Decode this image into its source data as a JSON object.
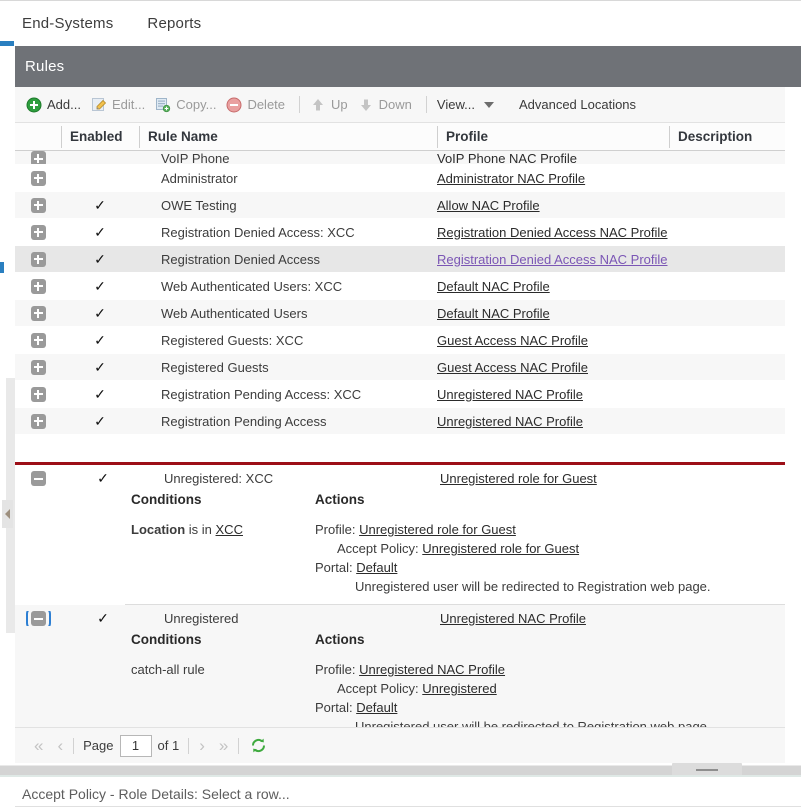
{
  "topbar": {
    "tabs": [
      {
        "label": "End-Systems"
      },
      {
        "label": "Reports"
      }
    ]
  },
  "panel": {
    "title": "Rules"
  },
  "toolbar": {
    "buttons": [
      {
        "label": "Add...",
        "icon": "add-circle-icon",
        "enabled": true
      },
      {
        "label": "Edit...",
        "icon": "edit-pencil-icon",
        "enabled": false
      },
      {
        "label": "Copy...",
        "icon": "copy-icon",
        "enabled": false
      },
      {
        "label": "Delete",
        "icon": "delete-circle-icon",
        "enabled": false
      },
      {
        "label": "Up",
        "icon": "arrow-up-icon",
        "enabled": false
      },
      {
        "label": "Down",
        "icon": "arrow-down-icon",
        "enabled": false
      },
      {
        "label": "View...",
        "icon": "chevron-down-icon",
        "enabled": true
      }
    ],
    "advanced_locations_label": "Advanced Locations"
  },
  "grid": {
    "columns": [
      {
        "key": "expand",
        "label": ""
      },
      {
        "key": "enabled",
        "label": "Enabled"
      },
      {
        "key": "rule_name",
        "label": "Rule Name"
      },
      {
        "key": "profile",
        "label": "Profile"
      },
      {
        "key": "description",
        "label": "Description"
      }
    ],
    "check_glyph": "✓",
    "rows": [
      {
        "enabled": "",
        "rule_name": "VoIP Phone",
        "profile": "VoIP Phone NAC Profile",
        "description": "",
        "expanded": false,
        "clipped": true,
        "visited": false,
        "selected": false
      },
      {
        "enabled": "",
        "rule_name": "Administrator",
        "profile": "Administrator NAC Profile",
        "description": "",
        "expanded": false,
        "clipped": false,
        "visited": false,
        "selected": false
      },
      {
        "enabled": "✓",
        "rule_name": "OWE Testing",
        "profile": "Allow NAC Profile",
        "description": "",
        "expanded": false,
        "clipped": false,
        "visited": false,
        "selected": false
      },
      {
        "enabled": "✓",
        "rule_name": "Registration Denied Access: XCC",
        "profile": "Registration Denied Access NAC Profile",
        "description": "",
        "expanded": false,
        "clipped": false,
        "visited": false,
        "selected": false
      },
      {
        "enabled": "✓",
        "rule_name": "Registration Denied Access",
        "profile": "Registration Denied Access NAC Profile",
        "description": "",
        "expanded": false,
        "clipped": false,
        "visited": true,
        "selected": true
      },
      {
        "enabled": "✓",
        "rule_name": "Web Authenticated Users: XCC",
        "profile": "Default NAC Profile",
        "description": "",
        "expanded": false,
        "clipped": false,
        "visited": false,
        "selected": false
      },
      {
        "enabled": "✓",
        "rule_name": "Web Authenticated Users",
        "profile": "Default NAC Profile",
        "description": "",
        "expanded": false,
        "clipped": false,
        "visited": false,
        "selected": false
      },
      {
        "enabled": "✓",
        "rule_name": "Registered Guests: XCC",
        "profile": "Guest Access NAC Profile",
        "description": "",
        "expanded": false,
        "clipped": false,
        "visited": false,
        "selected": false
      },
      {
        "enabled": "✓",
        "rule_name": "Registered Guests",
        "profile": "Guest Access NAC Profile",
        "description": "",
        "expanded": false,
        "clipped": false,
        "visited": false,
        "selected": false
      },
      {
        "enabled": "✓",
        "rule_name": "Registration Pending Access: XCC",
        "profile": "Unregistered NAC Profile",
        "description": "",
        "expanded": false,
        "clipped": false,
        "visited": false,
        "selected": false
      },
      {
        "enabled": "✓",
        "rule_name": "Registration Pending Access",
        "profile": "Unregistered NAC Profile",
        "description": "",
        "expanded": false,
        "clipped": false,
        "visited": false,
        "selected": false
      }
    ],
    "expanded_rules": [
      {
        "enabled": "✓",
        "rule_name": "Unregistered: XCC",
        "profile": "Unregistered role for Guest",
        "conditions_header": "Conditions",
        "actions_header": "Actions",
        "condition_prefix": "Location",
        "condition_middle": " is in ",
        "condition_value": "XCC",
        "profile_label": "Profile: ",
        "profile_value": "Unregistered role for Guest",
        "accept_policy_label": "Accept Policy: ",
        "accept_policy_value": "Unregistered role for Guest",
        "portal_label": "Portal: ",
        "portal_value": "Default",
        "portal_note": "Unregistered user will be redirected to Registration web page.",
        "focused": false
      },
      {
        "enabled": "✓",
        "rule_name": "Unregistered",
        "profile": "Unregistered NAC Profile",
        "conditions_header": "Conditions",
        "actions_header": "Actions",
        "condition_prefix": "catch-all rule",
        "condition_middle": "",
        "condition_value": "",
        "profile_label": "Profile: ",
        "profile_value": "Unregistered NAC Profile",
        "accept_policy_label": "Accept Policy: ",
        "accept_policy_value": "Unregistered",
        "portal_label": "Portal: ",
        "portal_value": "Default",
        "portal_note": "Unregistered user will be redirected to Registration web page.",
        "focused": true
      }
    ]
  },
  "pager": {
    "first_glyph": "«",
    "prev_glyph": "‹",
    "page_label": "Page",
    "page_value": "1",
    "of_label": "of 1",
    "next_glyph": "›",
    "last_glyph": "»",
    "refresh_icon": "refresh-icon"
  },
  "statusbar": {
    "text": "Accept Policy - Role Details: Select a row..."
  },
  "colors": {
    "panel_header": "#6f7277",
    "highlight_border": "#9c0f17",
    "accent_blue": "#2a7fc0",
    "visited_link": "#7b56b5",
    "add_green": "#2e9e3e",
    "delete_red": "#e06666",
    "refresh_green": "#3faa3f"
  }
}
